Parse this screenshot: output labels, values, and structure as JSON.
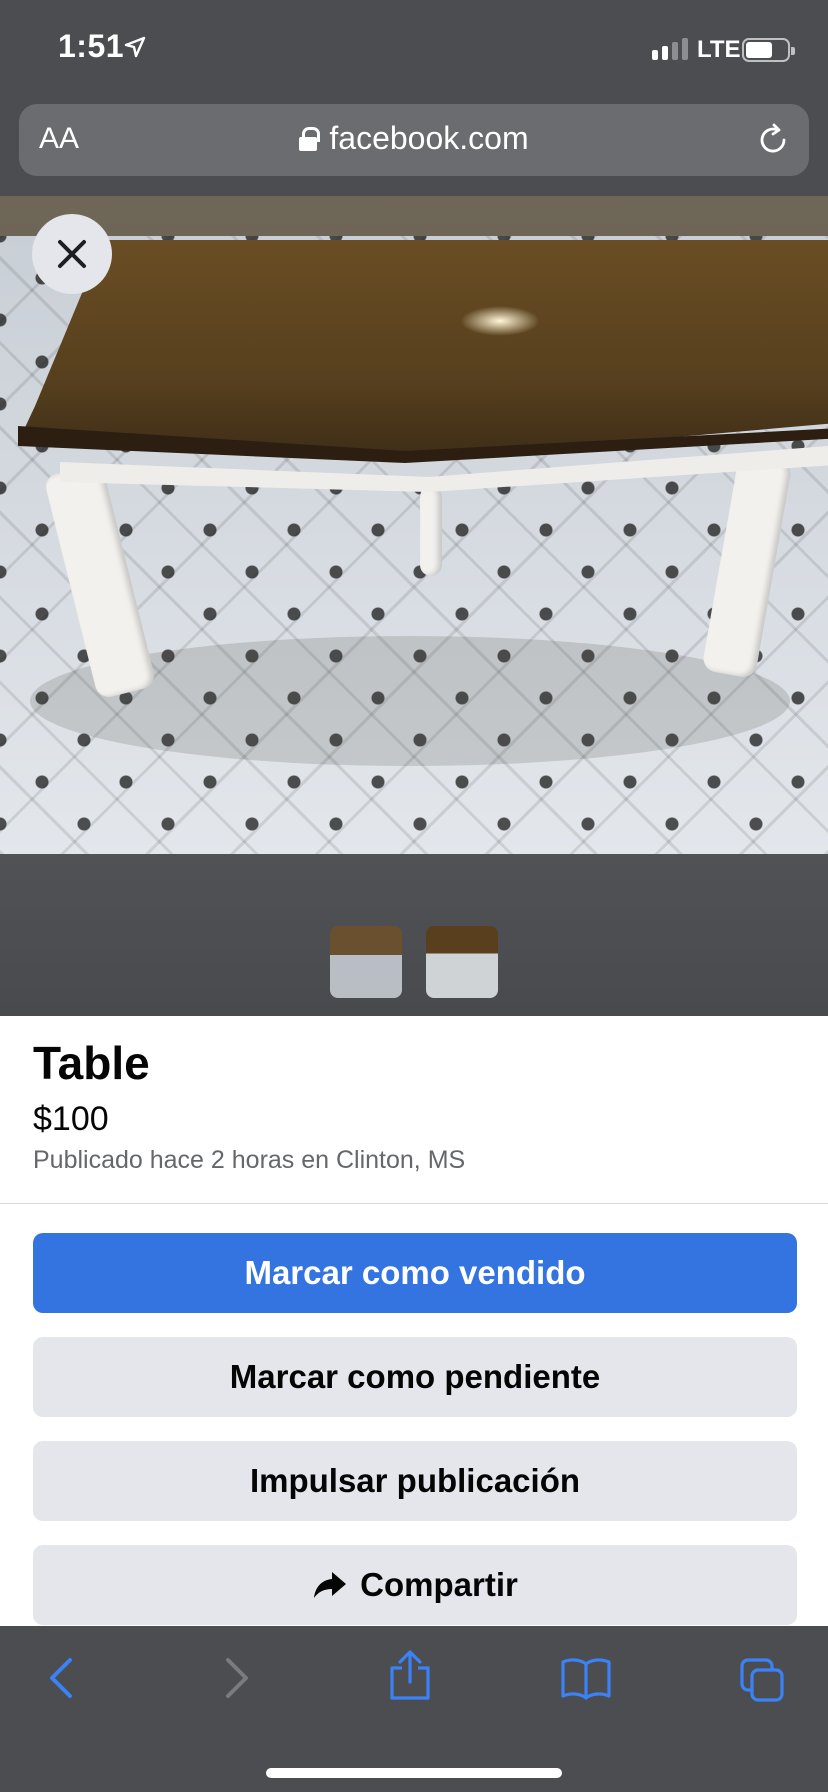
{
  "status_bar": {
    "time": "1:51",
    "network": "LTE",
    "signal_bars_filled": 2,
    "signal_bars_total": 4,
    "battery_level_fraction": 0.65
  },
  "url_bar": {
    "text_size_label": "AA",
    "domain": "facebook.com"
  },
  "listing": {
    "title": "Table",
    "price": "$100",
    "meta": "Publicado hace 2 horas en Clinton, MS",
    "photo_count": 2
  },
  "actions": {
    "mark_sold": "Marcar como vendido",
    "mark_pending": "Marcar como pendiente",
    "boost": "Impulsar publicación",
    "share": "Compartir"
  },
  "colors": {
    "primary_button": "#3474e0",
    "secondary_button": "#e4e6eb",
    "toolbar_icon": "#3b82f6",
    "chrome_bg": "#4c4d50"
  },
  "icons": {
    "close": "close-icon",
    "share": "share-arrow-icon",
    "reload": "reload-icon",
    "lock": "lock-icon",
    "back": "back-chevron-icon",
    "forward": "forward-chevron-icon",
    "safari_share": "safari-share-icon",
    "bookmarks": "bookmarks-icon",
    "tabs": "tabs-icon"
  }
}
